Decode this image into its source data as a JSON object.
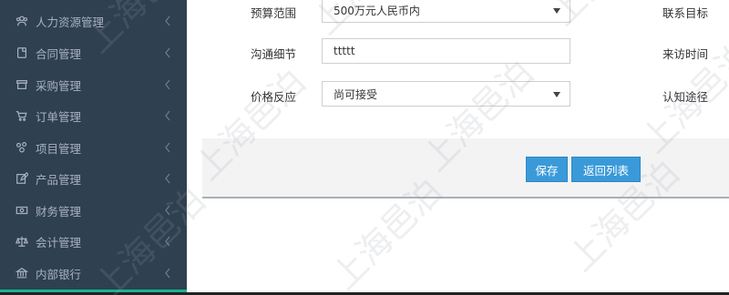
{
  "sidebar": {
    "items": [
      {
        "label": "人力资源管理",
        "icon": "users-icon"
      },
      {
        "label": "合同管理",
        "icon": "document-icon"
      },
      {
        "label": "采购管理",
        "icon": "box-icon"
      },
      {
        "label": "订单管理",
        "icon": "cart-icon"
      },
      {
        "label": "项目管理",
        "icon": "sitemap-icon"
      },
      {
        "label": "产品管理",
        "icon": "edit-icon"
      },
      {
        "label": "财务管理",
        "icon": "money-icon"
      },
      {
        "label": "会计管理",
        "icon": "scale-icon"
      },
      {
        "label": "内部银行",
        "icon": "bank-icon"
      }
    ]
  },
  "form": {
    "budget": {
      "label": "预算范围",
      "value": "500万元人民币内"
    },
    "contact_target_label": "联系目标",
    "communication": {
      "label": "沟通细节",
      "value": "ttttt"
    },
    "visit_time_label": "来访时间",
    "price": {
      "label": "价格反应",
      "value": "尚可接受"
    },
    "awareness_label": "认知途径"
  },
  "actions": {
    "save": "保存",
    "back": "返回列表"
  },
  "watermark": "上海邑泊",
  "colors": {
    "sidebar_bg": "#2f4050",
    "button_blue": "#3a9ad9",
    "accent": "#1ab394"
  }
}
